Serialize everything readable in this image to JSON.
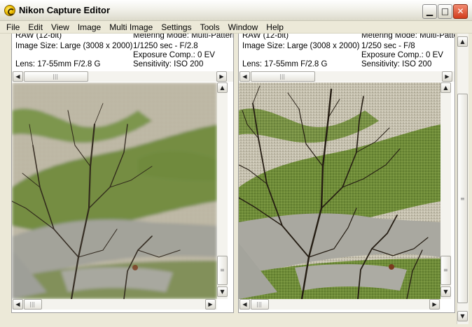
{
  "window": {
    "title": "Nikon Capture Editor",
    "min_glyph": "▁",
    "max_glyph": "□",
    "close_glyph": "✕"
  },
  "menu": [
    "File",
    "Edit",
    "View",
    "Image",
    "Multi Image",
    "Settings",
    "Tools",
    "Window",
    "Help"
  ],
  "scroll": {
    "up": "▲",
    "down": "▼",
    "left": "◀",
    "right": "▶",
    "grip_h": "|||",
    "grip_v": "≡"
  },
  "panes": [
    {
      "info": {
        "raw": "RAW (12-bit)",
        "image_size": "Image Size: Large (3008 x 2000)",
        "lens": "Lens: 17-55mm F/2.8 G",
        "metering": "Metering Mode: Multi-Pattern",
        "exposure": "1/1250 sec - F/2.8",
        "exp_comp": "Exposure Comp.: 0 EV",
        "sensitivity": "Sensitivity: ISO 200"
      }
    },
    {
      "info": {
        "raw": "RAW (12-bit)",
        "image_size": "Image Size: Large (3008 x 2000)",
        "lens": "Lens: 17-55mm F/2.8 G",
        "metering": "Metering Mode: Multi-Pattern",
        "exposure": "1/250 sec - F/8",
        "exp_comp": "Exposure Comp.: 0 EV",
        "sensitivity": "Sensitivity: ISO 200"
      }
    }
  ],
  "colors": {
    "gravel": "#b7b19e",
    "grass": "#6d8a3a",
    "path": "#9b9b92",
    "branch": "#2b2218"
  }
}
